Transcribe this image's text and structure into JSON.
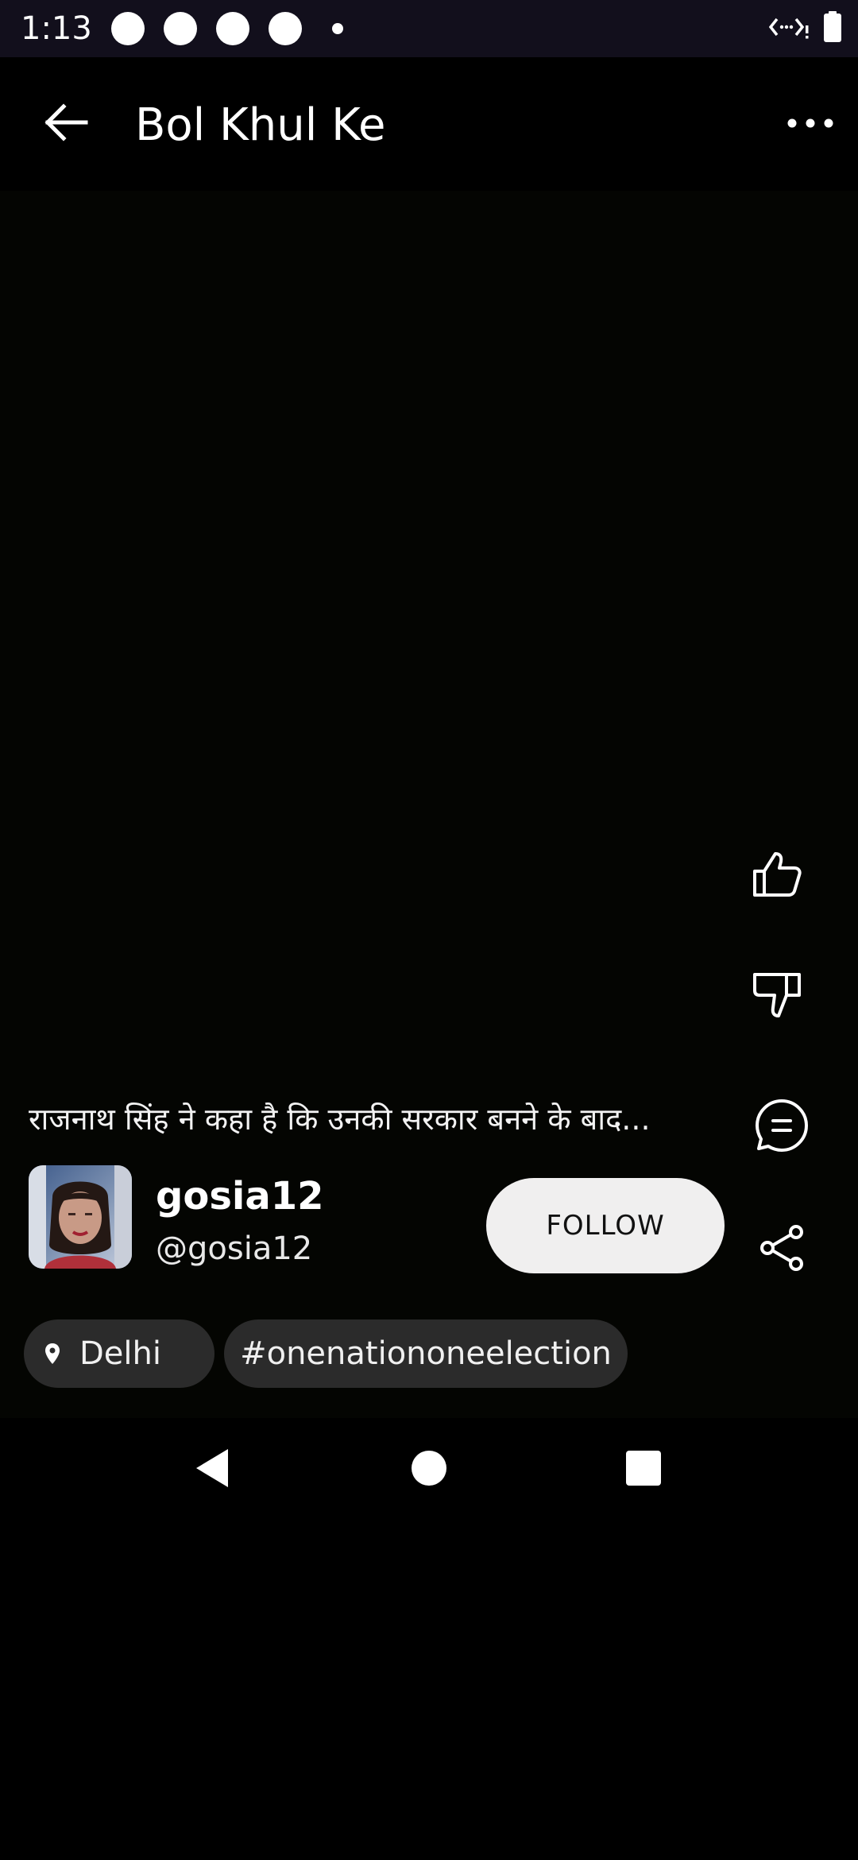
{
  "status_bar": {
    "time": "1:13",
    "icons": [
      "notification-dot-icon",
      "notification-dot-icon",
      "notification-dot-icon",
      "notification-dot-icon",
      "small-dot-icon",
      "data-saver-icon",
      "battery-icon"
    ]
  },
  "app_bar": {
    "title": "Bol Khul Ke",
    "back_icon": "arrow-left-icon",
    "more_icon": "more-horizontal-icon"
  },
  "post": {
    "caption": "राजनाथ सिंह ने कहा है कि उनकी सरकार बनने के बाद...",
    "author": {
      "name": "gosia12",
      "handle": "@gosia12"
    },
    "follow_label": "FOLLOW",
    "location": "Delhi",
    "hashtag": "#onenationoneelection"
  },
  "actions": [
    {
      "name": "like-button",
      "icon": "thumbs-up-icon"
    },
    {
      "name": "dislike-button",
      "icon": "thumbs-down-icon"
    },
    {
      "name": "comment-button",
      "icon": "comment-icon"
    },
    {
      "name": "share-button",
      "icon": "share-icon"
    }
  ],
  "nav_bar": {
    "icons": [
      "back-triangle-icon",
      "home-circle-icon",
      "recents-square-icon"
    ]
  },
  "colors": {
    "status_bar_bg": "#120f1c",
    "video_bg": "#040502",
    "chip_bg": "#2b2b2b",
    "follow_bg": "#f0efef"
  }
}
